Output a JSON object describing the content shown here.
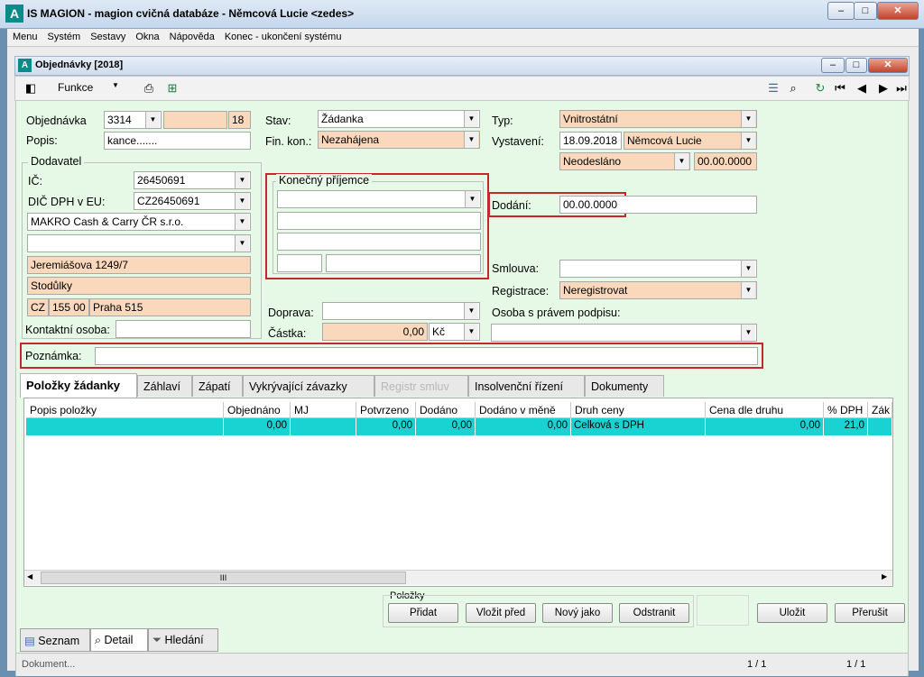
{
  "window": {
    "title": "IS MAGION - magion cvičná databáze - Němcová Lucie <zedes>",
    "logo": "A"
  },
  "menu": [
    "Menu",
    "Systém",
    "Sestavy",
    "Okna",
    "Nápověda",
    "Konec - ukončení systému"
  ],
  "child": {
    "title": "Objednávky [2018]",
    "toolbar_funkce": "Funkce"
  },
  "form": {
    "objednavka_label": "Objednávka",
    "objednavka_value": "3314",
    "objednavka_extra": "18",
    "popis_label": "Popis:",
    "popis_value": "kance.......",
    "dodavatel_label": "Dodavatel",
    "ic_label": "IČ:",
    "ic_value": "26450691",
    "dic_label": "DIČ DPH v EU:",
    "dic_value": "CZ26450691",
    "firma": "MAKRO Cash & Carry ČR s.r.o.",
    "ulice": "Jeremiášova 1249/7",
    "mesto": "Stodůlky",
    "zeme": "CZ",
    "psc": "155 00",
    "obec": "Praha 515",
    "kontakt_label": "Kontaktní osoba:",
    "stav_label": "Stav:",
    "stav_value": "Žádanka",
    "finkon_label": "Fin. kon.:",
    "finkon_value": "Nezahájena",
    "konecny_label": "Konečný příjemce",
    "doprava_label": "Doprava:",
    "castka_label": "Částka:",
    "castka_value": "0,00",
    "mena_value": "Kč",
    "typ_label": "Typ:",
    "typ_value": "Vnitrostátní",
    "vystaveni_label": "Vystavení:",
    "vystaveni_date": "18.09.2018",
    "vystaveni_osoba": "Němcová Lucie",
    "odeslano_value": "Neodesláno",
    "odeslano_date": "00.00.0000",
    "dodani_label": "Dodání:",
    "dodani_value": "00.00.0000",
    "smlouva_label": "Smlouva:",
    "registrace_label": "Registrace:",
    "registrace_value": "Neregistrovat",
    "osoba_label": "Osoba s právem podpisu:",
    "poznamka_label": "Poznámka:"
  },
  "tabs": [
    "Položky žádanky",
    "Záhlaví",
    "Zápatí",
    "Vykrývající závazky",
    "Registr smluv",
    "Insolvenční řízení",
    "Dokumenty"
  ],
  "grid": {
    "headers": [
      "Popis položky",
      "Objednáno",
      "MJ",
      "Potvrzeno",
      "Dodáno",
      "Dodáno v měně",
      "Druh ceny",
      "Cena dle druhu",
      "% DPH",
      "Zák"
    ],
    "row": [
      "",
      "0,00",
      "",
      "0,00",
      "0,00",
      "0,00",
      "Celková s DPH",
      "0,00",
      "21,0",
      ""
    ],
    "scroll_mark": "III"
  },
  "buttons": {
    "polozky_label": "Položky",
    "pridat": "Přidat",
    "vlozit": "Vložit před",
    "novy": "Nový jako",
    "odstranit": "Odstranit",
    "ulozit": "Uložit",
    "prerusit": "Přerušit"
  },
  "bottom_tabs": [
    "Seznam",
    "Detail",
    "Hledání"
  ],
  "status": {
    "left": "Dokument...",
    "c1": "1 / 1",
    "c2": "1 / 1"
  },
  "colors": {
    "row_highlight": "#19d3d3",
    "form_bg": "#e6f9e6",
    "peach": "#fad8bc",
    "annotation": "#c8262a"
  }
}
